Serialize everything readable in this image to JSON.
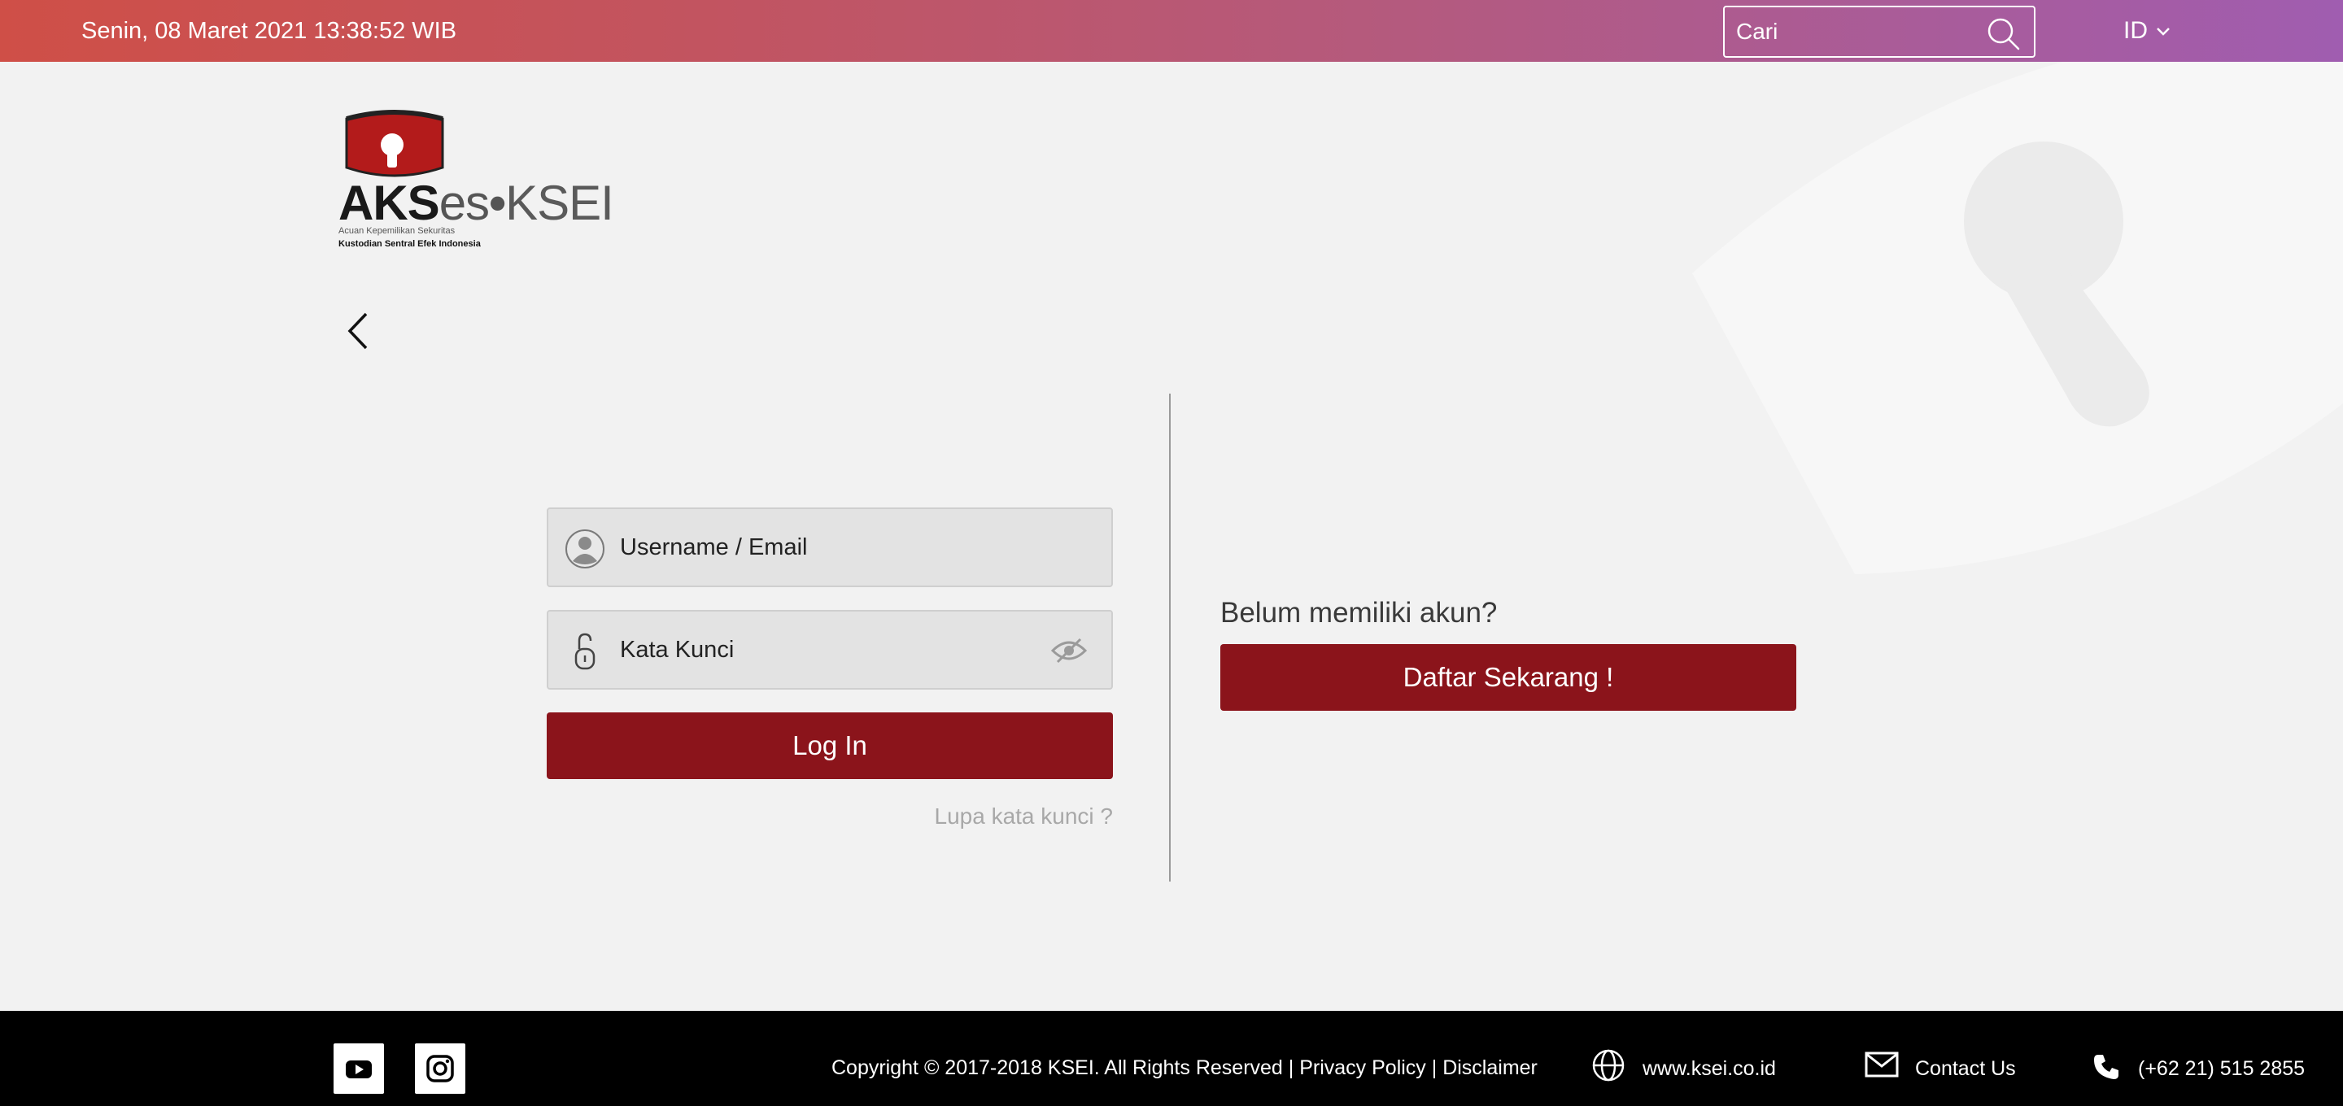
{
  "topbar": {
    "datetime": "Senin, 08 Maret 2021 13:38:52 WIB",
    "search_placeholder": "Cari",
    "language": "ID"
  },
  "logo": {
    "word_aks": "AKS",
    "word_es": "es",
    "word_dot": "•",
    "word_ksei": "KSEI",
    "tagline": "Acuan Kepemilikan Sekuritas",
    "org": "Kustodian Sentral Efek Indonesia"
  },
  "login": {
    "username_placeholder": "Username / Email",
    "password_placeholder": "Kata Kunci",
    "login_label": "Log In",
    "forgot_label": "Lupa kata kunci ?"
  },
  "register": {
    "question": "Belum memiliki akun?",
    "button_label": "Daftar Sekarang !"
  },
  "footer": {
    "copyright": "Copyright © 2017-2018 KSEI. All Rights Reserved | ",
    "privacy": "Privacy Policy",
    "separator": " | ",
    "disclaimer": "Disclaimer",
    "website": "www.ksei.co.id",
    "contact": "Contact Us",
    "phone": "(+62 21) 515 2855"
  },
  "colors": {
    "brand_red": "#8b141b",
    "topbar_start": "#cf4f47",
    "topbar_end": "#a05db0"
  },
  "icons": [
    "search-icon",
    "chevron-down-icon",
    "back-arrow-icon",
    "user-icon",
    "lock-icon",
    "eye-slash-icon",
    "youtube-icon",
    "instagram-icon",
    "globe-icon",
    "mail-icon",
    "phone-icon"
  ]
}
